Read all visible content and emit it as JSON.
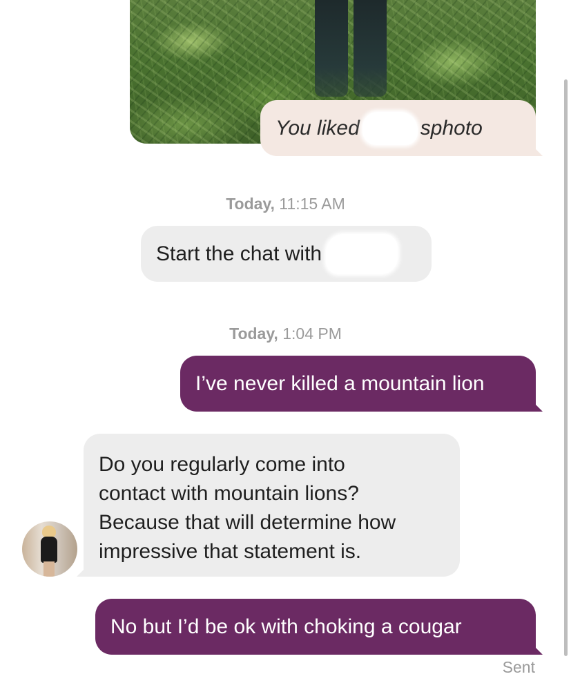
{
  "liked_message": {
    "prefix": "You liked ",
    "suffix": " photo",
    "visible_fragment": "s"
  },
  "timestamps": [
    {
      "day": "Today,",
      "time": " 11:15 AM"
    },
    {
      "day": "Today,",
      "time": " 1:04 PM"
    }
  ],
  "start_chat": {
    "text": "Start the chat with"
  },
  "messages": [
    {
      "direction": "outgoing",
      "text": "I’ve never killed a mountain lion"
    },
    {
      "direction": "incoming",
      "text": "Do you regularly come into\ncontact with mountain lions?\nBecause that will determine how\nimpressive that statement is."
    },
    {
      "direction": "outgoing",
      "text": "No but I’d be ok with choking a cougar"
    }
  ],
  "status": {
    "sent_label": "Sent"
  },
  "colors": {
    "outgoing_bubble": "#6b2a63",
    "incoming_bubble": "#ededed",
    "liked_bubble": "#f4e8e2",
    "timestamp_text": "#9a9a9a"
  },
  "icons": {
    "avatar": "profile-photo"
  }
}
